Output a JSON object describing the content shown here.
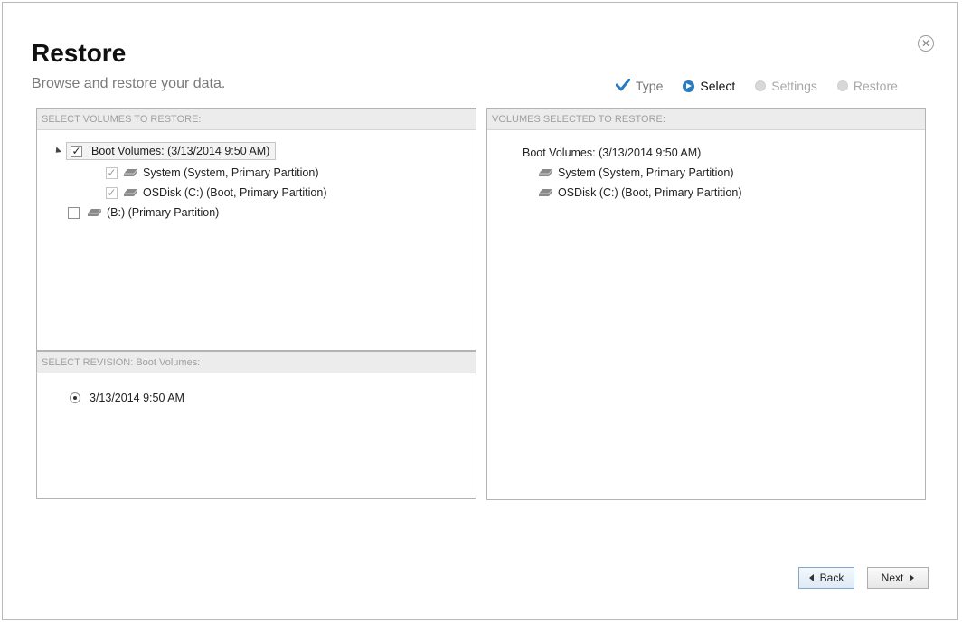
{
  "header": {
    "title": "Restore",
    "subtitle": "Browse and restore your data."
  },
  "steps": [
    {
      "label": "Type",
      "state": "done",
      "icon": "check-icon"
    },
    {
      "label": "Select",
      "state": "active",
      "icon": "arrow-circle-icon"
    },
    {
      "label": "Settings",
      "state": "pending",
      "icon": "circle-icon"
    },
    {
      "label": "Restore",
      "state": "pending",
      "icon": "circle-icon"
    }
  ],
  "volumes_panel": {
    "header": "SELECT VOLUMES TO RESTORE:",
    "items": [
      {
        "label": "Boot Volumes: (3/13/2014 9:50 AM)",
        "checked": true,
        "expanded": true
      },
      {
        "label": "System (System, Primary Partition)",
        "checked": true,
        "icon": "disk-icon"
      },
      {
        "label": "OSDisk (C:) (Boot, Primary Partition)",
        "checked": true,
        "icon": "disk-icon"
      },
      {
        "label": "(B:) (Primary Partition)",
        "checked": false,
        "icon": "disk-icon"
      }
    ]
  },
  "revision_panel": {
    "header": "SELECT REVISION: Boot Volumes:",
    "revisions": [
      {
        "label": "3/13/2014 9:50 AM",
        "selected": true
      }
    ]
  },
  "selected_panel": {
    "header": "VOLUMES SELECTED TO RESTORE:",
    "group": "Boot Volumes: (3/13/2014 9:50 AM)",
    "items": [
      {
        "label": "System (System, Primary Partition)",
        "icon": "disk-icon"
      },
      {
        "label": "OSDisk (C:) (Boot, Primary Partition)",
        "icon": "disk-icon"
      }
    ]
  },
  "buttons": {
    "back": "Back",
    "next": "Next"
  },
  "colors": {
    "accent": "#2a7bbf"
  }
}
